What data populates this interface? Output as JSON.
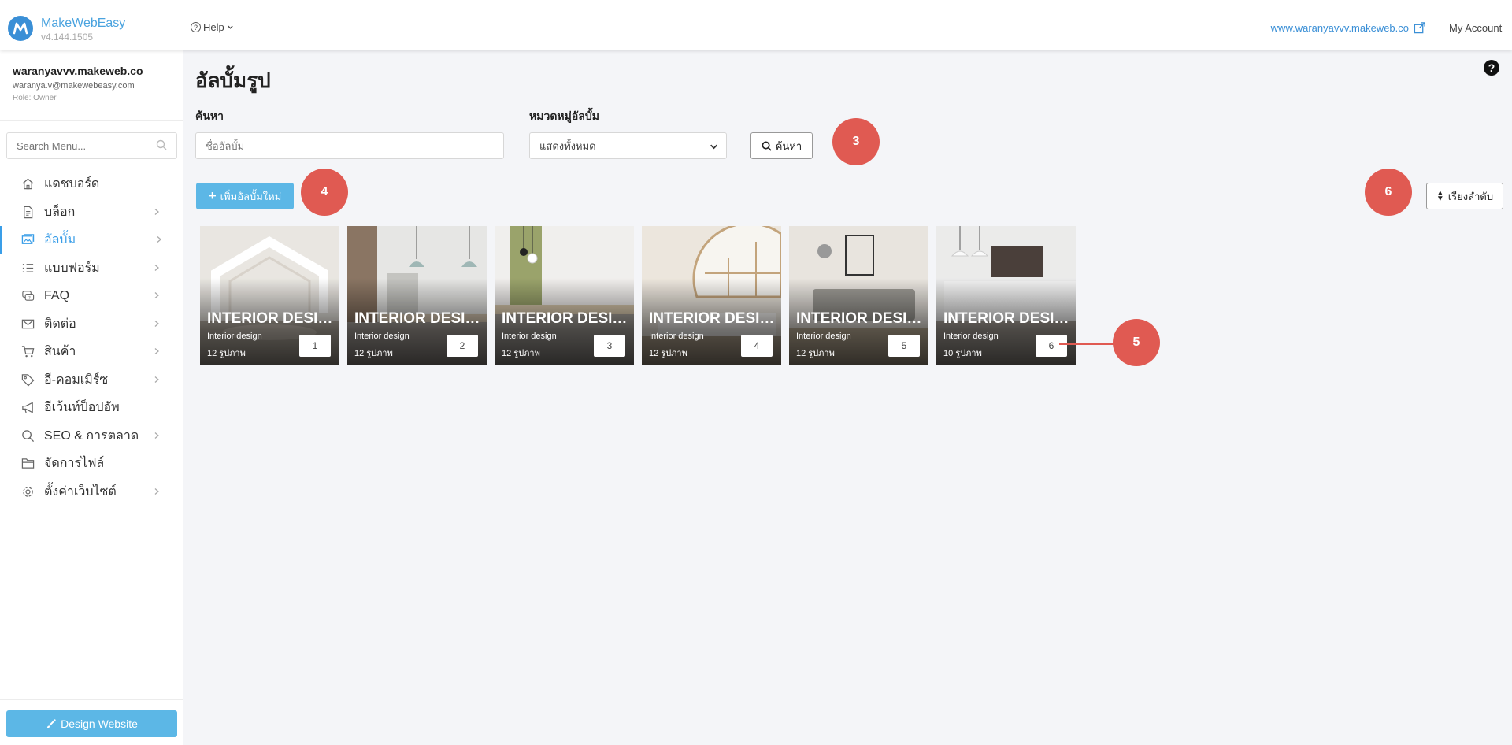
{
  "topbar": {
    "brand_name": "MakeWebEasy",
    "version": "v4.144.1505",
    "help_label": "Help",
    "site_url": "www.waranyavvv.makeweb.co",
    "my_account_label": "My Account"
  },
  "sidebar": {
    "site_name": "waranyavvv.makeweb.co",
    "email": "waranya.v@makewebeasy.com",
    "role": "Role: Owner",
    "search_placeholder": "Search Menu...",
    "items": [
      {
        "label": "แดชบอร์ด",
        "icon": "home-icon",
        "has_children": false
      },
      {
        "label": "บล็อก",
        "icon": "document-icon",
        "has_children": true
      },
      {
        "label": "อัลบั้ม",
        "icon": "photo-album-icon",
        "has_children": true,
        "active": true
      },
      {
        "label": "แบบฟอร์ม",
        "icon": "form-list-icon",
        "has_children": true
      },
      {
        "label": "FAQ",
        "icon": "faq-bubble-icon",
        "has_children": true
      },
      {
        "label": "ติดต่อ",
        "icon": "envelope-icon",
        "has_children": true
      },
      {
        "label": "สินค้า",
        "icon": "cart-icon",
        "has_children": true
      },
      {
        "label": "อี-คอมเมิร์ซ",
        "icon": "tag-icon",
        "has_children": true
      },
      {
        "label": "อีเว้นท์ป็อปอัพ",
        "icon": "megaphone-icon",
        "has_children": false
      },
      {
        "label": "SEO & การตลาด",
        "icon": "search-icon",
        "has_children": true
      },
      {
        "label": "จัดการไฟล์",
        "icon": "folder-icon",
        "has_children": false
      },
      {
        "label": "ตั้งค่าเว็บไซต์",
        "icon": "gear-icon",
        "has_children": true
      }
    ],
    "design_button": "Design Website"
  },
  "main": {
    "title": "อัลบั้มรูป",
    "search_label": "ค้นหา",
    "search_placeholder": "ชื่ออัลบั้ม",
    "category_label": "หมวดหมู่อัลบั้ม",
    "category_selected": "แสดงทั้งหมด",
    "search_button": "ค้นหา",
    "add_button": "เพิ่มอัลบั้มใหม่",
    "sort_button": "เรียงลำดับ",
    "callouts": [
      "3",
      "4",
      "5",
      "6"
    ],
    "albums": [
      {
        "title": "INTERIOR DESIGN",
        "category": "Interior design",
        "count": "12 รูปภาพ",
        "order": "1"
      },
      {
        "title": "INTERIOR DESIGN",
        "category": "Interior design",
        "count": "12 รูปภาพ",
        "order": "2"
      },
      {
        "title": "INTERIOR DESIGN",
        "category": "Interior design",
        "count": "12 รูปภาพ",
        "order": "3"
      },
      {
        "title": "INTERIOR DESIGN",
        "category": "Interior design",
        "count": "12 รูปภาพ",
        "order": "4"
      },
      {
        "title": "INTERIOR DESIGN",
        "category": "Interior design",
        "count": "12 รูปภาพ",
        "order": "5"
      },
      {
        "title": "INTERIOR DESIGN",
        "category": "Interior design",
        "count": "10 รูปภาพ",
        "order": "6"
      }
    ]
  },
  "colors": {
    "accent": "#5cb7e6",
    "link": "#3a8fd6",
    "callout": "#e05a52"
  }
}
